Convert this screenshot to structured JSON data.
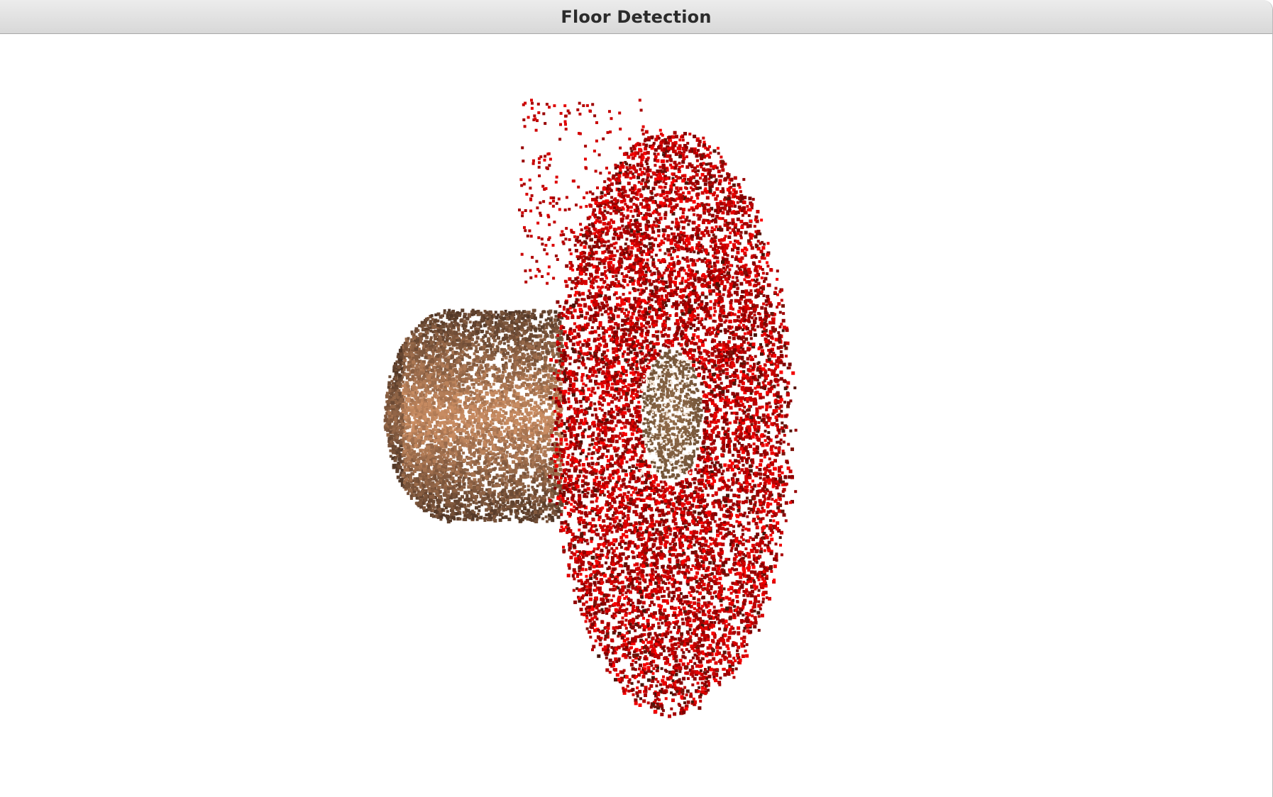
{
  "window": {
    "title": "Floor Detection"
  },
  "viewport": {
    "content": "point-cloud",
    "background_color": "#ffffff",
    "colors": {
      "floor_points": "#e00000",
      "object_points": "#a9785a",
      "object_shadow": "#3a2a20"
    }
  }
}
